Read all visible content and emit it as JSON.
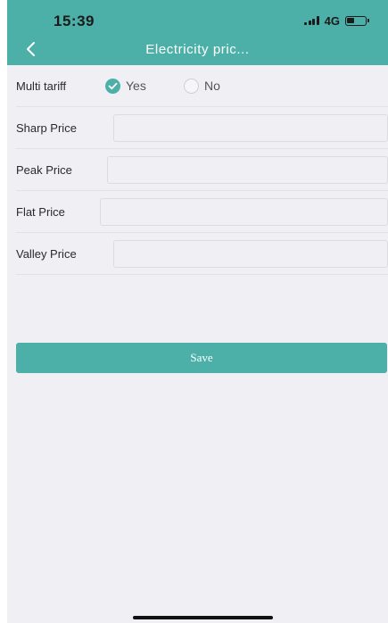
{
  "status_bar": {
    "time": "15:39",
    "network": "4G"
  },
  "header": {
    "title": "Electricity pric...",
    "back_icon": "chevron-left-icon",
    "background_color": "#4cb0a8"
  },
  "form": {
    "multi_tariff": {
      "label": "Multi tariff",
      "options": [
        {
          "label": "Yes",
          "selected": true
        },
        {
          "label": "No",
          "selected": false
        }
      ]
    },
    "fields": [
      {
        "label": "Sharp Price",
        "value": ""
      },
      {
        "label": "Peak Price",
        "value": ""
      },
      {
        "label": "Flat Price",
        "value": ""
      },
      {
        "label": "Valley Price",
        "value": ""
      }
    ],
    "save_label": "Save"
  },
  "colors": {
    "accent": "#4cb0a8",
    "page_background": "#f0eff4"
  }
}
